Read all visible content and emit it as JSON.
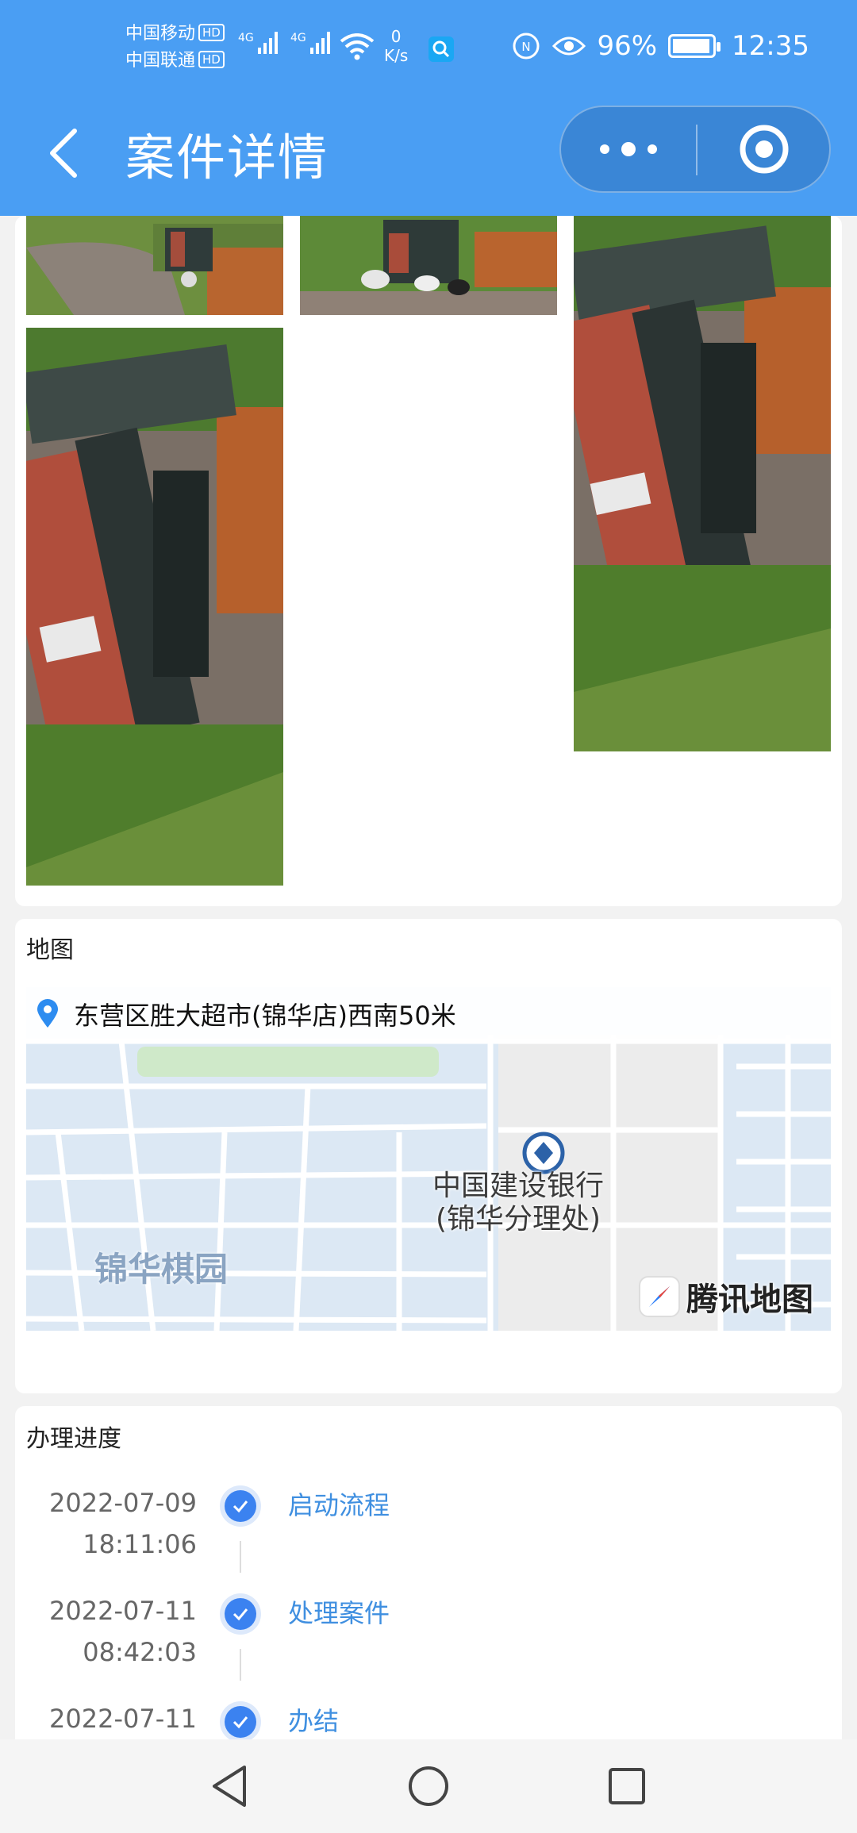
{
  "status_bar": {
    "carrier1": "中国移动",
    "carrier2": "中国联通",
    "hd_badge": "HD",
    "network_type": "4G",
    "speed_value": "0",
    "speed_unit": "K/s",
    "battery_percent": "96%",
    "battery_level": 0.96,
    "time": "12:35",
    "icons": [
      "wifi-icon",
      "search-app-icon",
      "nfc-icon",
      "eye-comfort-icon",
      "battery-icon"
    ]
  },
  "header": {
    "title": "案件详情",
    "back_icon": "chevron-left-icon",
    "more_icon": "more-dots-icon",
    "close_icon": "target-close-icon"
  },
  "photos": {
    "items": [
      {
        "name": "photo-1",
        "subject": "trash bin on paved path"
      },
      {
        "name": "photo-2",
        "subject": "trash bin with litter"
      },
      {
        "name": "photo-3",
        "subject": "trash bin close-up"
      },
      {
        "name": "photo-4",
        "subject": "trash bin close-up"
      }
    ]
  },
  "map_section": {
    "title": "地图",
    "address": "东营区胜大超市(锦华店)西南50米",
    "poi_line1": "中国建设银行",
    "poi_line2": "(锦华分理处)",
    "area_label": "锦华棋园",
    "provider": "腾讯地图"
  },
  "progress_section": {
    "title": "办理进度",
    "steps": [
      {
        "date": "2022-07-09",
        "time": "18:11:06",
        "label": "启动流程"
      },
      {
        "date": "2022-07-11",
        "time": "08:42:03",
        "label": "处理案件"
      },
      {
        "date": "2022-07-11",
        "time": "",
        "label": "办结"
      }
    ]
  },
  "nav_bar": {
    "back_icon": "triangle-back-icon",
    "home_icon": "circle-home-icon",
    "recents_icon": "square-recents-icon"
  }
}
